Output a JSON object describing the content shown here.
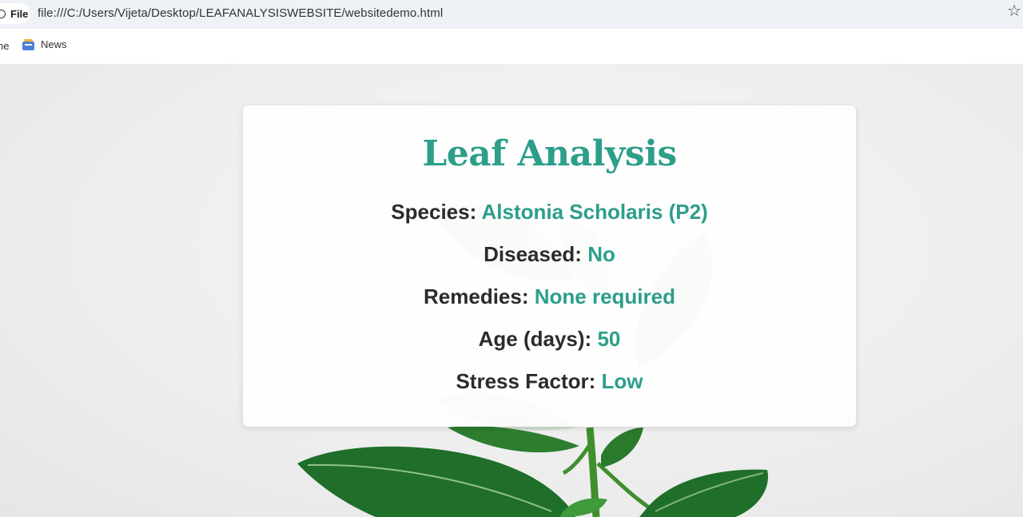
{
  "browser": {
    "scheme_chip": "File",
    "url": "file:///C:/Users/Vijeta/Desktop/LEAFANALYSISWEBSITE/websitedemo.html",
    "bookmarks": [
      {
        "label": "ne"
      },
      {
        "label": "News",
        "icon": "news-icon"
      }
    ],
    "bookmark_icon": "star-icon"
  },
  "card": {
    "title": "Leaf Analysis",
    "fields": [
      {
        "label": "Species:",
        "value": "Alstonia Scholaris (P2)"
      },
      {
        "label": "Diseased:",
        "value": "No"
      },
      {
        "label": "Remedies:",
        "value": "None required"
      },
      {
        "label": "Age (days):",
        "value": "50"
      },
      {
        "label": "Stress Factor:",
        "value": "Low"
      }
    ]
  },
  "colors": {
    "accent": "#2c9e8a",
    "label": "#2b2b2b",
    "leaf_dark": "#1f6e2a",
    "leaf_light": "#3f9a3c"
  }
}
